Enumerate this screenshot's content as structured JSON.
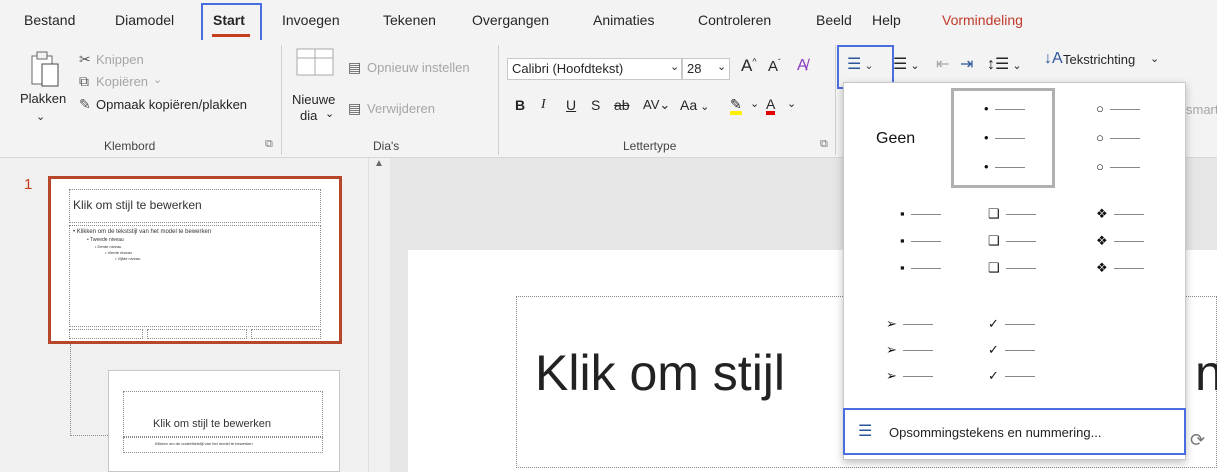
{
  "tabs": [
    "Bestand",
    "Diamodel",
    "Start",
    "Invoegen",
    "Tekenen",
    "Overgangen",
    "Animaties",
    "Controleren",
    "Beeld",
    "Help",
    "Vormindeling"
  ],
  "clipboard": {
    "paste": "Plakken",
    "cut": "Knippen",
    "copy": "Kopiëren",
    "format_painter": "Opmaak kopiëren/plakken",
    "group": "Klembord"
  },
  "slides_group": {
    "new_slide_1": "Nieuwe",
    "new_slide_2": "dia",
    "reset": "Opnieuw instellen",
    "delete": "Verwijderen",
    "group": "Dia's"
  },
  "font_group": {
    "font": "Calibri (Hoofdtekst)",
    "size": "28",
    "group": "Lettertype",
    "case": "Aa"
  },
  "paragraph": {
    "text_direction": "Tekstrichting",
    "cut_off": "smart"
  },
  "thumb1": {
    "title": "Klik om stijl te bewerken",
    "lines": [
      "• Klikken om de tekststijl van het model te bewerken",
      "• Tweede niveau",
      "• Derde niveau",
      "• Vierde niveau",
      "• Vijfde niveau"
    ]
  },
  "thumb2": {
    "title": "Klik om stijl te bewerken",
    "subtitle": "Klikken om de ondertitelstijl van het model te bewerken"
  },
  "slide": {
    "title_visible": "Klik om stijl"
  },
  "bullets_gallery": {
    "none_label": "Geen",
    "styles": [
      "filled-round",
      "hollow-round",
      "filled-square",
      "hollow-square",
      "diamond-cluster",
      "arrow",
      "check"
    ],
    "bottom_label": "Opsommingstekens en nummering..."
  },
  "colors": {
    "accent": "#c43e1c",
    "highlight": "#4a6ee0"
  }
}
